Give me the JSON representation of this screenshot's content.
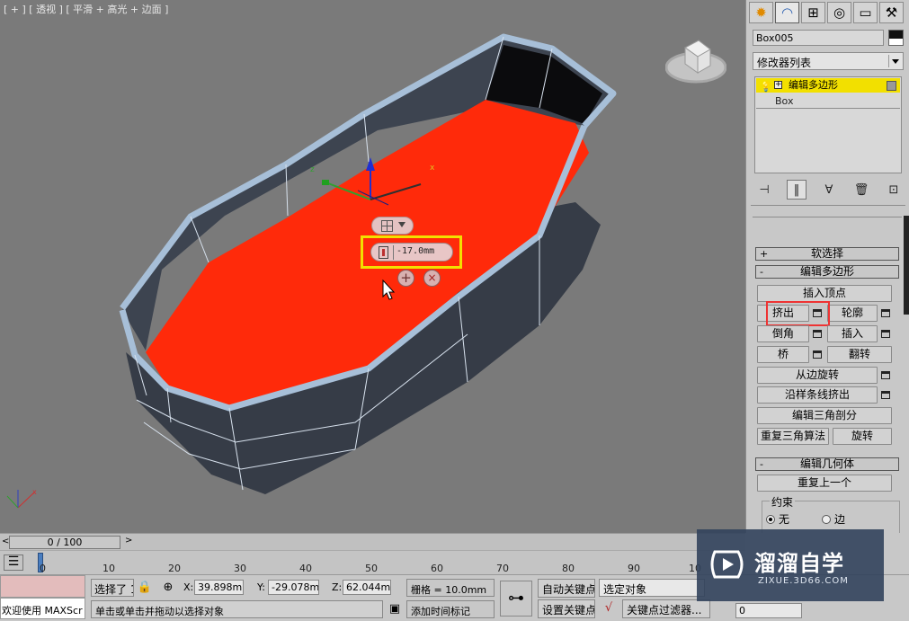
{
  "viewport": {
    "label": "[ + ] [ 透视 ] [ 平滑 + 高光 + 边面 ]",
    "selection_color": "#ff2a0a",
    "mesh_color": "#39404c",
    "rim_color": "#a7bfd8",
    "background": "#7a7a7a"
  },
  "caddy": {
    "grid_icon": "grid-icon",
    "amount_value": "-17.0mm",
    "ok_symbol": "+",
    "cancel_symbol": "×"
  },
  "cmd_panel": {
    "tabs": [
      {
        "icon": "create-icon",
        "glyph": "✹"
      },
      {
        "icon": "modify-icon",
        "glyph": "◠"
      },
      {
        "icon": "hierarchy-icon",
        "glyph": "⊞"
      },
      {
        "icon": "motion-icon",
        "glyph": "◎"
      },
      {
        "icon": "display-icon",
        "glyph": "▭"
      },
      {
        "icon": "utilities-icon",
        "glyph": "⚒"
      }
    ],
    "object_name": "Box005",
    "modifier_list": "修改器列表",
    "stack": [
      "编辑多边形",
      "Box"
    ],
    "rollouts": {
      "soft_selection": {
        "sign": "+",
        "title": "软选择"
      },
      "edit_poly": {
        "sign": "-",
        "title": "编辑多边形"
      },
      "edit_geometry": {
        "sign": "-",
        "title": "编辑几何体"
      }
    },
    "buttons": {
      "insert_vertex": "插入顶点",
      "extrude": "挤出",
      "outline": "轮廓",
      "bevel": "倒角",
      "inset": "插入",
      "bridge": "桥",
      "flip": "翻转",
      "hinge": "从边旋转",
      "extrude_spline": "沿样条线挤出",
      "edit_tri": "编辑三角剖分",
      "retriangulate": "重复三角算法",
      "turn": "旋转",
      "repeat_last": "重复上一个"
    },
    "constraint": {
      "title": "约束",
      "none": "无",
      "edge": "边"
    }
  },
  "timeline": {
    "left_arrow": "<",
    "frame_display": "0 / 100",
    "right_arrow": ">",
    "ticks": [
      "0",
      "10",
      "20",
      "30",
      "40",
      "50",
      "60",
      "70",
      "80",
      "90",
      "10"
    ]
  },
  "status": {
    "welcome": "欢迎使用 MAXScr",
    "selected": "选择了 1",
    "x_label": "X:",
    "x_value": "39.898mm",
    "y_label": "Y:",
    "y_value": "-29.078mm",
    "z_label": "Z:",
    "z_value": "62.044mm",
    "grid": "栅格 = 10.0mm",
    "prompt": "单击或单击并拖动以选择对象",
    "add_time_tag": "添加时间标记",
    "auto_key": "自动关键点",
    "selected_object": "选定对象",
    "set_key": "设置关键点",
    "key_filters": "关键点过滤器...",
    "frame": "0"
  },
  "watermark": {
    "cn": "溜溜自学",
    "en": "ZIXUE.3D66.COM"
  }
}
